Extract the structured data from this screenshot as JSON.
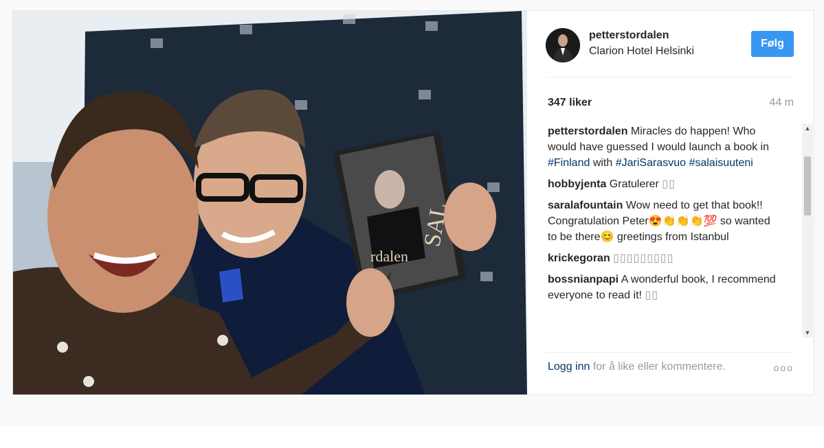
{
  "post": {
    "username": "petterstordalen",
    "location": "Clarion Hotel Helsinki",
    "follow_label": "Følg",
    "likes": "347 liker",
    "time": "44 m",
    "book_title": "rdalen",
    "book_spine": "SAL"
  },
  "comments": [
    {
      "user": "petterstordalen",
      "text_a": " Miracles do happen! Who would have guessed I would launch a book in ",
      "tag1": "#Finland",
      "text_b": " with ",
      "tag2": "#JariSarasvuo",
      "text_c": " ",
      "tag3": "#salaisuuteni"
    },
    {
      "user": "hobbyjenta",
      "text": " Gratulerer ",
      "boxes": "▯▯"
    },
    {
      "user": "saralafountain",
      "text": " Wow need to get that book!! Congratulation Peter😍👏👏👏💯 so wanted to be there😊 greetings from Istanbul"
    },
    {
      "user": "krickegoran",
      "text": " ",
      "boxes": "▯▯▯▯▯▯▯▯▯"
    },
    {
      "user": "bossnianpapi",
      "text": " A wonderful book, I recommend everyone to read it! ",
      "boxes": "▯▯"
    }
  ],
  "footer": {
    "login": "Logg inn",
    "rest": " for å like eller kommentere.",
    "more": "ooo"
  },
  "scroll": {
    "up": "▲",
    "down": "▼"
  }
}
